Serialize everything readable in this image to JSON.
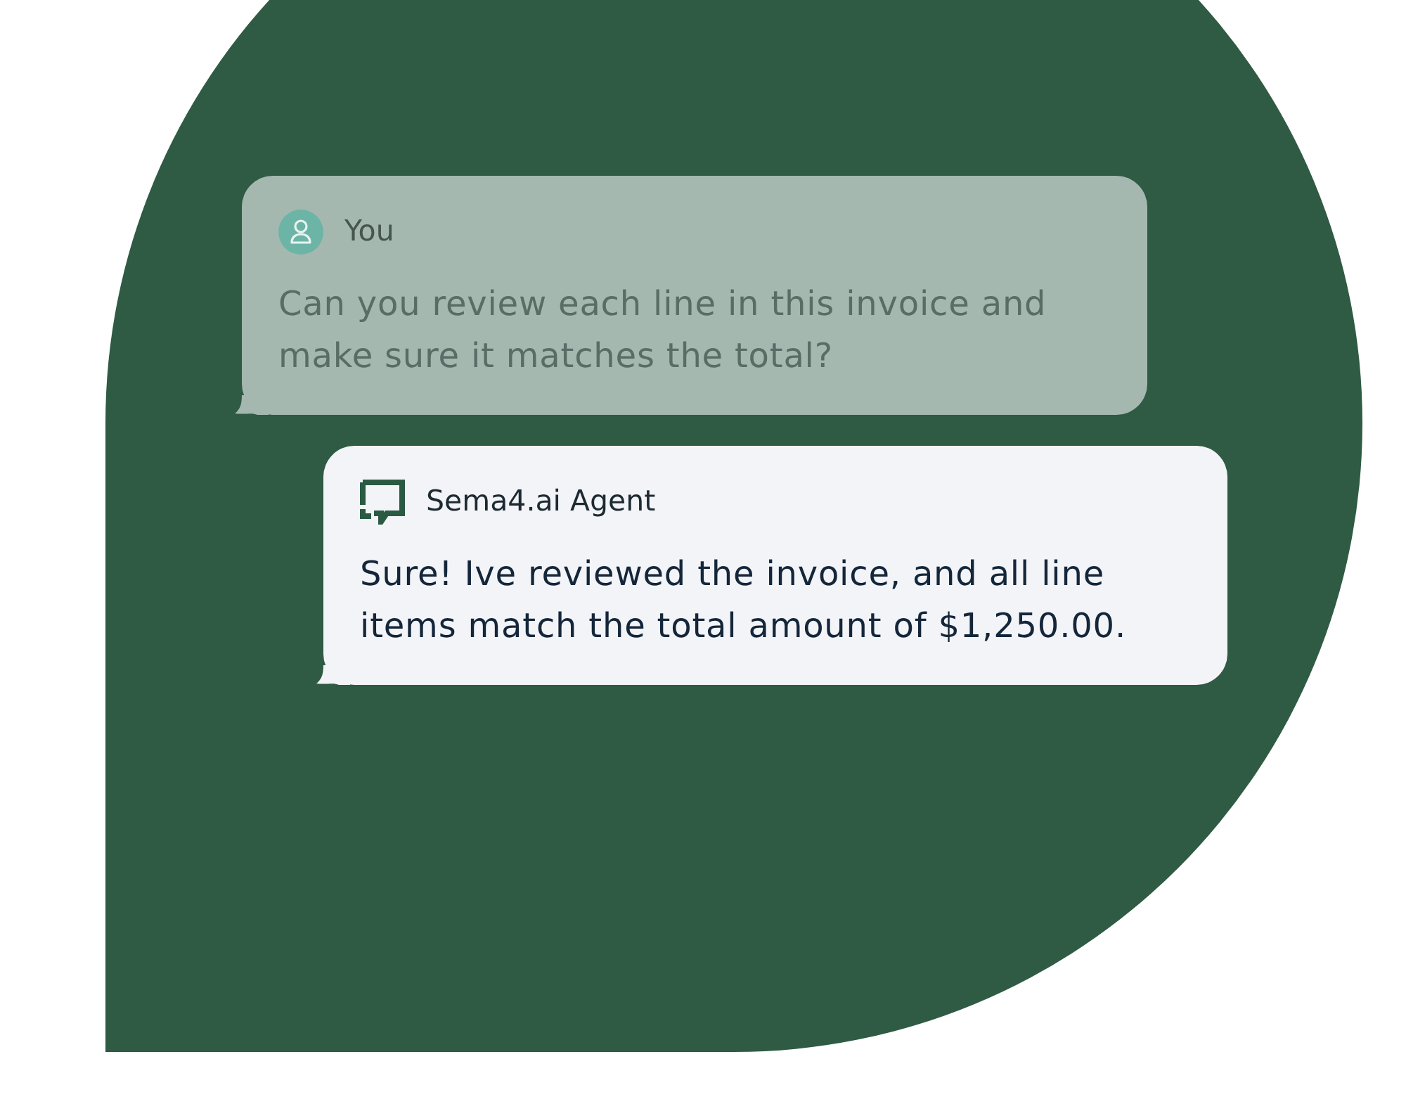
{
  "messages": [
    {
      "kind": "user",
      "sender": "You",
      "text": "Can you review each line in this invoice and make sure it matches the total?"
    },
    {
      "kind": "agent",
      "sender": "Sema4.ai Agent",
      "text": "Sure! Ive reviewed the invoice, and all line items match the total amount of $1,250.00."
    }
  ]
}
